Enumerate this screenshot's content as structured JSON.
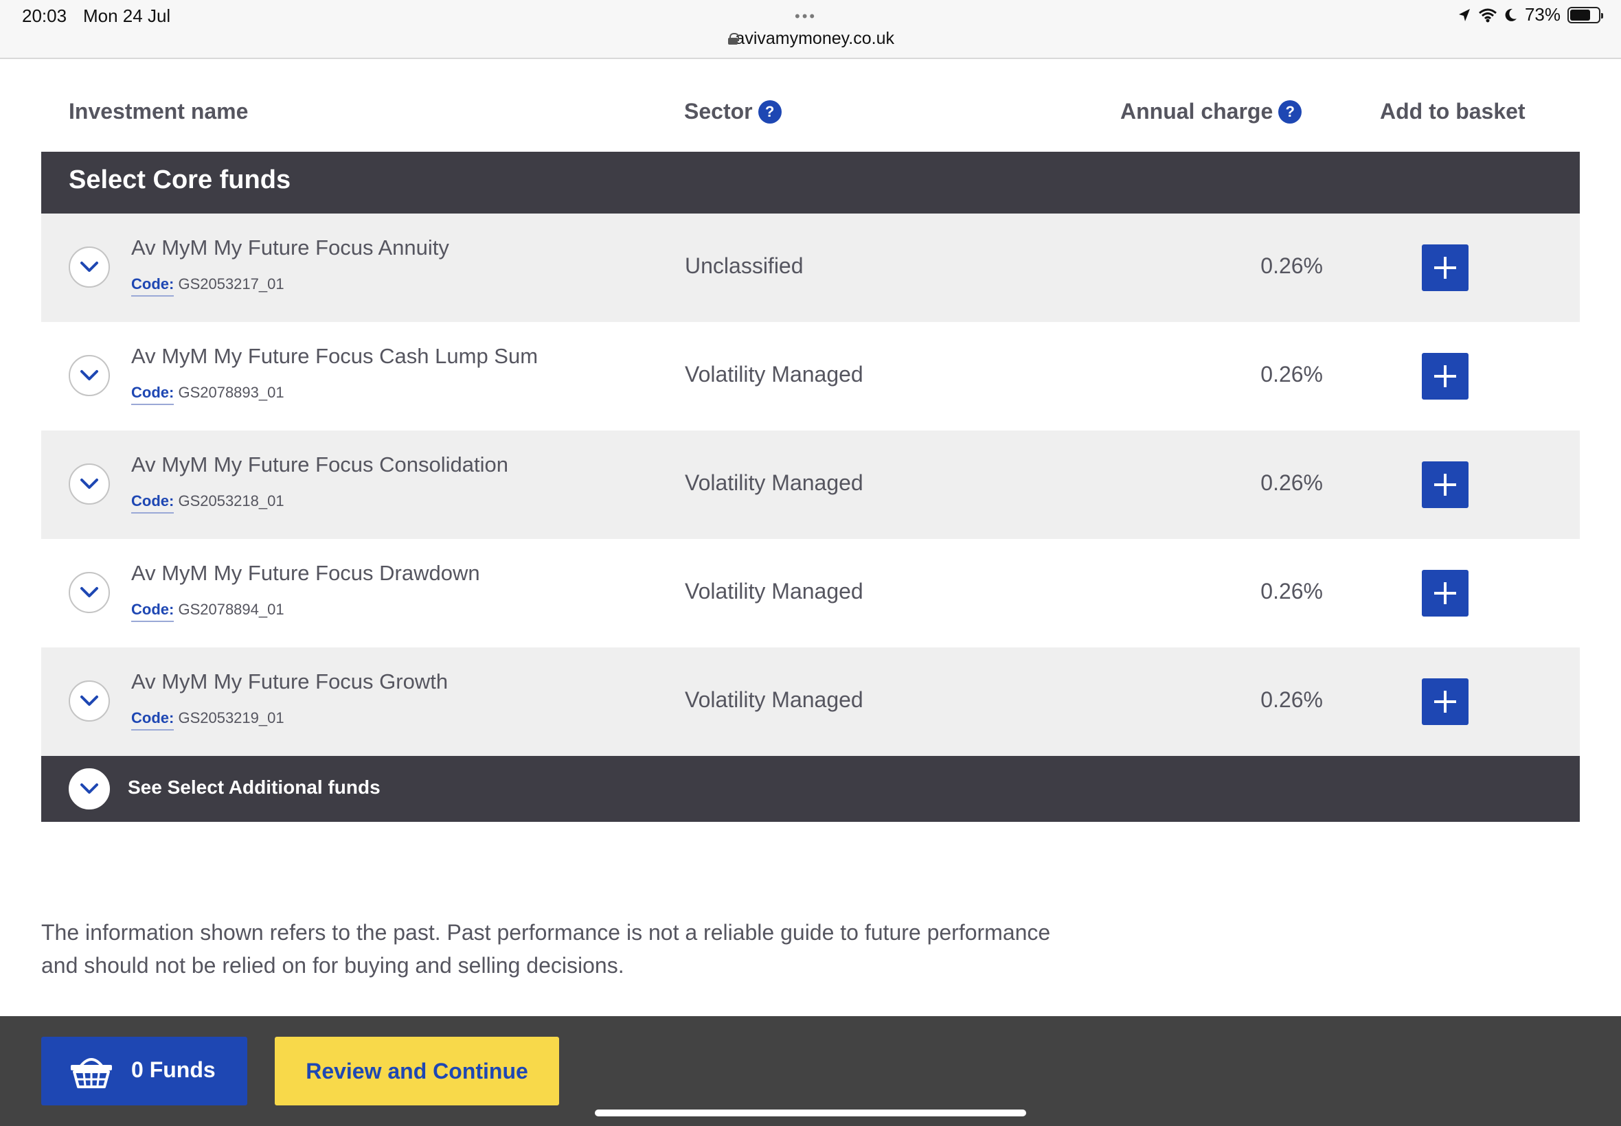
{
  "status_bar": {
    "time": "20:03",
    "date": "Mon 24 Jul",
    "dots": "•••",
    "url": "avivamymoney.co.uk",
    "battery_percent": "73%"
  },
  "table_header": {
    "investment_name": "Investment name",
    "sector": "Sector",
    "annual_charge": "Annual charge",
    "add_to_basket": "Add to basket",
    "help_icon_text": "?"
  },
  "section": {
    "title": "Select Core funds"
  },
  "funds": [
    {
      "name": "Av MyM My Future Focus Annuity",
      "code_label": "Code:",
      "code": "GS2053217_01",
      "sector": "Unclassified",
      "charge": "0.26%"
    },
    {
      "name": "Av MyM My Future Focus Cash Lump Sum",
      "code_label": "Code:",
      "code": "GS2078893_01",
      "sector": "Volatility Managed",
      "charge": "0.26%"
    },
    {
      "name": "Av MyM My Future Focus Consolidation",
      "code_label": "Code:",
      "code": "GS2053218_01",
      "sector": "Volatility Managed",
      "charge": "0.26%"
    },
    {
      "name": "Av MyM My Future Focus Drawdown",
      "code_label": "Code:",
      "code": "GS2078894_01",
      "sector": "Volatility Managed",
      "charge": "0.26%"
    },
    {
      "name": "Av MyM My Future Focus Growth",
      "code_label": "Code:",
      "code": "GS2053219_01",
      "sector": "Volatility Managed",
      "charge": "0.26%"
    }
  ],
  "additional": {
    "label": "See Select Additional funds"
  },
  "disclaimer": "The information shown refers to the past. Past performance is not a reliable guide to future performance and should not be relied on for buying and selling decisions.",
  "footer": {
    "basket_label": "0 Funds",
    "review_label": "Review and Continue"
  },
  "colors": {
    "brand_blue": "#1e47b3",
    "dark_header": "#3e3d45",
    "yellow": "#f8d94a",
    "footer_bg": "#434343"
  },
  "icons": [
    "lock-icon",
    "location-icon",
    "wifi-icon",
    "moon-icon",
    "battery-icon",
    "help-icon",
    "chevron-down-icon",
    "plus-icon",
    "basket-icon"
  ]
}
